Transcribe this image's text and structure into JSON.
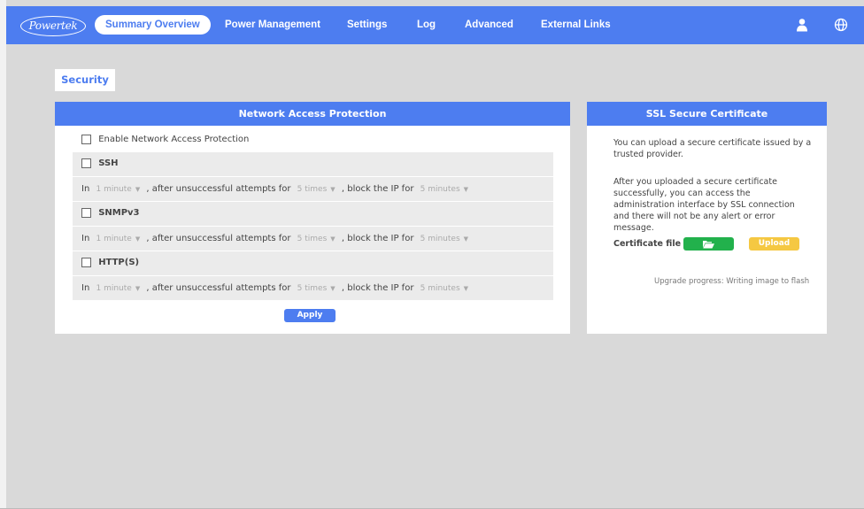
{
  "brand": {
    "logo_text": "Powertek"
  },
  "nav": {
    "items": [
      {
        "label": "Summary Overview"
      },
      {
        "label": "Power Management"
      },
      {
        "label": "Settings"
      },
      {
        "label": "Log"
      },
      {
        "label": "Advanced"
      },
      {
        "label": "External Links"
      }
    ],
    "active_index": 0
  },
  "page": {
    "tab_label": "Security"
  },
  "network_access": {
    "title": "Network Access Protection",
    "enable_label": "Enable Network Access Protection",
    "enable_checked": false,
    "rule_text": {
      "in": "In",
      "after": ", after unsuccessful attempts for",
      "block": ", block the IP for"
    },
    "protocols": [
      {
        "label": "SSH",
        "checked": false,
        "period": "1 minute",
        "attempts": "5 times",
        "block_duration": "5 minutes"
      },
      {
        "label": "SNMPv3",
        "checked": false,
        "period": "1 minute",
        "attempts": "5 times",
        "block_duration": "5 minutes"
      },
      {
        "label": "HTTP(S)",
        "checked": false,
        "period": "1 minute",
        "attempts": "5 times",
        "block_duration": "5 minutes"
      }
    ],
    "apply_label": "Apply"
  },
  "ssl": {
    "title": "SSL Secure Certificate",
    "intro": "You can upload a secure certificate issued by a trusted provider.",
    "info": "After you uploaded a secure certificate successfully, you can access the administration interface by SSL connection and there will not be any alert or error message.",
    "cert_label": "Certificate file :",
    "upload_label": "Upload",
    "progress_text": "Upgrade progress: Writing image to flash"
  },
  "colors": {
    "accent": "#4d7df0",
    "background": "#d9d9d9",
    "row_bg": "#ebebeb",
    "browse_button": "#22b14c",
    "upload_button": "#f5c842"
  },
  "icons": [
    "user-icon",
    "globe-icon",
    "folder-open-icon",
    "caret-down-icon"
  ]
}
